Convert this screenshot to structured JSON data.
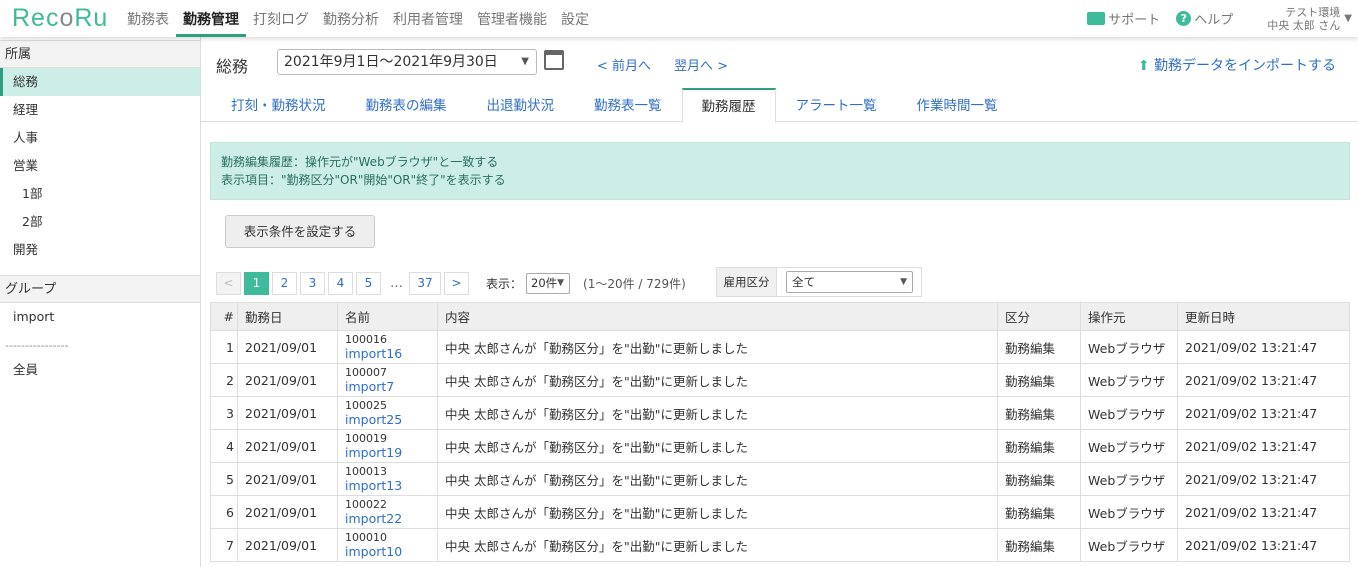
{
  "header": {
    "logo": "RecoRu",
    "nav": [
      "勤務表",
      "勤務管理",
      "打刻ログ",
      "勤務分析",
      "利用者管理",
      "管理者機能",
      "設定"
    ],
    "active_nav": 1,
    "support": "サポート",
    "help": "ヘルプ",
    "env": "テスト環境",
    "user": "中央 太郎 さん"
  },
  "sidebar": {
    "dept_header": "所属",
    "depts": [
      "総務",
      "経理",
      "人事",
      "営業",
      "1部",
      "2部",
      "開発"
    ],
    "group_header": "グループ",
    "groups": [
      "import"
    ],
    "separator": "----------------",
    "all": "全員"
  },
  "main": {
    "title": "総務",
    "period": "2021年9月1日～2021年9月30日",
    "prev": "< 前月へ",
    "next": "翌月へ >",
    "import": "勤務データをインポートする",
    "tabs": [
      "打刻・勤務状況",
      "勤務表の編集",
      "出退勤状況",
      "勤務表一覧",
      "勤務履歴",
      "アラート一覧",
      "作業時間一覧"
    ],
    "info": [
      "勤務編集履歴：操作元が\"Webブラウザ\"と一致する",
      "表示項目：\"勤務区分\"OR\"開始\"OR\"終了\"を表示する"
    ],
    "cond_button": "表示条件を設定する",
    "pagination": {
      "prev": "<",
      "pages": [
        "1",
        "2",
        "3",
        "4",
        "5"
      ],
      "dots": "…",
      "last": "37",
      "next": ">",
      "display_label": "表示：",
      "per_page": "20件",
      "count": "(1～20件 / 729件)"
    },
    "employment": {
      "label": "雇用区分",
      "value": "全て"
    },
    "columns": [
      "#",
      "勤務日",
      "名前",
      "内容",
      "区分",
      "操作元",
      "更新日時"
    ],
    "rows": [
      {
        "no": "1",
        "date": "2021/09/01",
        "id": "100016",
        "name": "import16",
        "content": "中央 太郎さんが「勤務区分」を\"出勤\"に更新しました",
        "type": "勤務編集",
        "source": "Webブラウザ",
        "updated": "2021/09/02 13:21:47"
      },
      {
        "no": "2",
        "date": "2021/09/01",
        "id": "100007",
        "name": "import7",
        "content": "中央 太郎さんが「勤務区分」を\"出勤\"に更新しました",
        "type": "勤務編集",
        "source": "Webブラウザ",
        "updated": "2021/09/02 13:21:47"
      },
      {
        "no": "3",
        "date": "2021/09/01",
        "id": "100025",
        "name": "import25",
        "content": "中央 太郎さんが「勤務区分」を\"出勤\"に更新しました",
        "type": "勤務編集",
        "source": "Webブラウザ",
        "updated": "2021/09/02 13:21:47"
      },
      {
        "no": "4",
        "date": "2021/09/01",
        "id": "100019",
        "name": "import19",
        "content": "中央 太郎さんが「勤務区分」を\"出勤\"に更新しました",
        "type": "勤務編集",
        "source": "Webブラウザ",
        "updated": "2021/09/02 13:21:47"
      },
      {
        "no": "5",
        "date": "2021/09/01",
        "id": "100013",
        "name": "import13",
        "content": "中央 太郎さんが「勤務区分」を\"出勤\"に更新しました",
        "type": "勤務編集",
        "source": "Webブラウザ",
        "updated": "2021/09/02 13:21:47"
      },
      {
        "no": "6",
        "date": "2021/09/01",
        "id": "100022",
        "name": "import22",
        "content": "中央 太郎さんが「勤務区分」を\"出勤\"に更新しました",
        "type": "勤務編集",
        "source": "Webブラウザ",
        "updated": "2021/09/02 13:21:47"
      },
      {
        "no": "7",
        "date": "2021/09/01",
        "id": "100010",
        "name": "import10",
        "content": "中央 太郎さんが「勤務区分」を\"出勤\"に更新しました",
        "type": "勤務編集",
        "source": "Webブラウザ",
        "updated": "2021/09/02 13:21:47"
      }
    ]
  }
}
